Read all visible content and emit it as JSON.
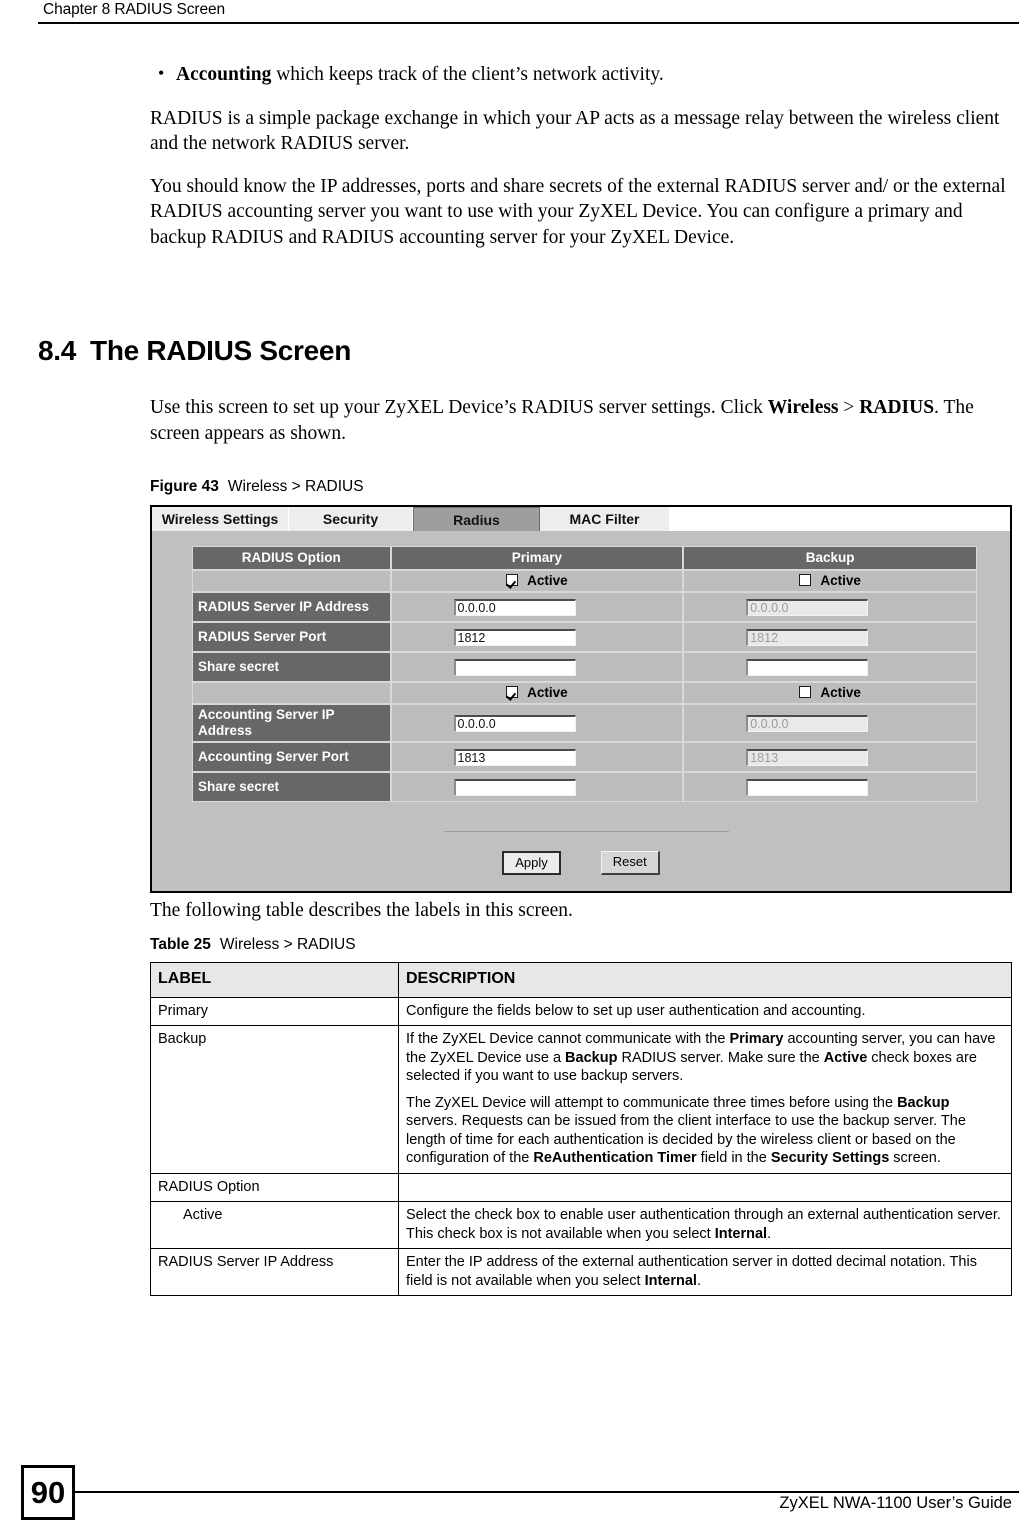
{
  "page": {
    "running_header": "Chapter 8 RADIUS Screen",
    "page_number": "90",
    "footer_guide": "ZyXEL NWA-1100 User’s Guide"
  },
  "intro": {
    "bullet_term": "Accounting",
    "bullet_rest": " which keeps track of the client’s network activity.",
    "para1": "RADIUS is a simple package exchange in which your AP acts as a message relay between the wireless client and the network RADIUS server.",
    "para2": "You should know the IP addresses, ports and share secrets of the external RADIUS server and/ or the external RADIUS accounting server you want to use with your ZyXEL Device. You can configure a primary and backup RADIUS and RADIUS accounting server for your ZyXEL Device."
  },
  "section": {
    "number": "8.4",
    "title": "The RADIUS Screen",
    "body_pre": "Use this screen to set up your ZyXEL Device’s RADIUS server settings. Click ",
    "body_bold1": "Wireless",
    "body_mid": " > ",
    "body_bold2": "RADIUS",
    "body_post": ". The screen appears as shown."
  },
  "figure": {
    "caption_label": "Figure 43",
    "caption_text": "Wireless > RADIUS",
    "tabs": [
      {
        "label": "Wireless Settings",
        "active": false
      },
      {
        "label": "Security",
        "active": false
      },
      {
        "label": "Radius",
        "active": true
      },
      {
        "label": "MAC Filter",
        "active": false
      }
    ],
    "columns": {
      "option": "RADIUS Option",
      "primary": "Primary",
      "backup": "Backup"
    },
    "active_label": "Active",
    "rows": [
      {
        "type": "active",
        "label": "",
        "primary_checked": "checked",
        "backup_checked": "unchecked"
      },
      {
        "type": "input",
        "label": "RADIUS Server IP Address",
        "primary_value": "0.0.0.0",
        "backup_value": "0.0.0.0"
      },
      {
        "type": "input",
        "label": "RADIUS Server Port",
        "primary_value": "1812",
        "backup_value": "1812"
      },
      {
        "type": "input",
        "label": "Share secret",
        "primary_value": "",
        "backup_value": ""
      },
      {
        "type": "active",
        "label": "",
        "primary_checked": "checked",
        "backup_checked": "unchecked"
      },
      {
        "type": "input",
        "label": "Accounting Server IP Address",
        "primary_value": "0.0.0.0",
        "backup_value": "0.0.0.0"
      },
      {
        "type": "input",
        "label": "Accounting Server Port",
        "primary_value": "1813",
        "backup_value": "1813"
      },
      {
        "type": "input",
        "label": "Share secret",
        "primary_value": "",
        "backup_value": ""
      }
    ],
    "buttons": {
      "apply": "Apply",
      "reset": "Reset"
    },
    "colors": {
      "panel_bg": "#c0c0c2",
      "row_label_bg": "#666769",
      "cell_bg": "#bcbcbe",
      "tab_active_bg": "#9e9e9e",
      "tab_inactive_bg": "#eceded"
    }
  },
  "table_intro": "The following table describes the labels in this screen.",
  "table25": {
    "caption_label": "Table 25",
    "caption_text": "Wireless > RADIUS",
    "headers": [
      "LABEL",
      "DESCRIPTION"
    ],
    "rows": [
      {
        "label": "Primary",
        "indent": false,
        "paragraphs": [
          {
            "segments": [
              {
                "t": "Configure the fields below to set up user authentication and accounting.",
                "b": false
              }
            ]
          }
        ]
      },
      {
        "label": "Backup",
        "indent": false,
        "paragraphs": [
          {
            "segments": [
              {
                "t": "If the ZyXEL Device cannot communicate with the ",
                "b": false
              },
              {
                "t": "Primary",
                "b": true
              },
              {
                "t": " accounting server, you can have the ZyXEL Device use a ",
                "b": false
              },
              {
                "t": "Backup",
                "b": true
              },
              {
                "t": " RADIUS server. Make sure the ",
                "b": false
              },
              {
                "t": "Active",
                "b": true
              },
              {
                "t": " check boxes are selected if you want to use backup servers.",
                "b": false
              }
            ]
          },
          {
            "segments": [
              {
                "t": "The ZyXEL Device will attempt to communicate three times before using the ",
                "b": false
              },
              {
                "t": "Backup",
                "b": true
              },
              {
                "t": " servers. Requests can be issued from the client interface to use the backup server. The length of time for each authentication is decided by the wireless client or based on the configuration of the ",
                "b": false
              },
              {
                "t": "ReAuthentication Timer",
                "b": true
              },
              {
                "t": " field in the ",
                "b": false
              },
              {
                "t": "Security Settings",
                "b": true
              },
              {
                "t": " screen.",
                "b": false
              }
            ]
          }
        ]
      },
      {
        "label": "RADIUS Option",
        "indent": false,
        "paragraphs": []
      },
      {
        "label": "Active",
        "indent": true,
        "paragraphs": [
          {
            "segments": [
              {
                "t": "Select the check box to enable user authentication through an external authentication server. This check box is not available when you select ",
                "b": false
              },
              {
                "t": "Internal",
                "b": true
              },
              {
                "t": ".",
                "b": false
              }
            ]
          }
        ]
      },
      {
        "label": "RADIUS Server IP Address",
        "indent": false,
        "paragraphs": [
          {
            "segments": [
              {
                "t": "Enter the IP address of the external authentication server in dotted decimal notation. This field is not available when you select ",
                "b": false
              },
              {
                "t": "Internal",
                "b": true
              },
              {
                "t": ".",
                "b": false
              }
            ]
          }
        ]
      }
    ]
  }
}
